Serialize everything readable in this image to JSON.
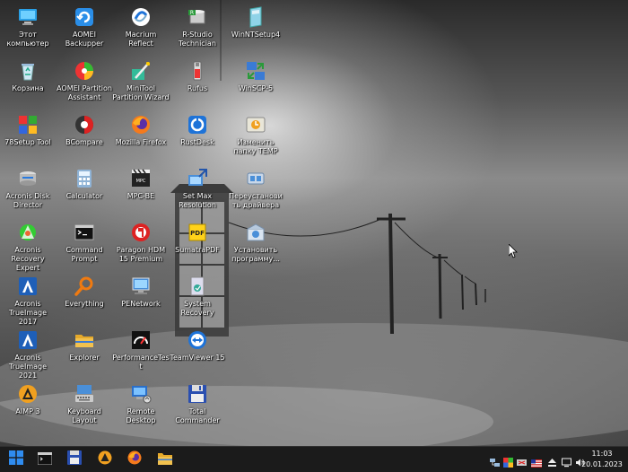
{
  "desktop": {
    "icons": [
      {
        "label": "Этот компьютер",
        "icon": "this-pc-icon"
      },
      {
        "label": "Корзина",
        "icon": "recycle-bin-icon"
      },
      {
        "label": "78Setup Tool",
        "icon": "setup-tool-icon"
      },
      {
        "label": "Acronis Disk Director",
        "icon": "acronis-disk-director-icon"
      },
      {
        "label": "Acronis Recovery Expert",
        "icon": "acronis-recovery-expert-icon"
      },
      {
        "label": "Acronis TrueImage 2017",
        "icon": "acronis-trueimage-icon"
      },
      {
        "label": "Acronis TrueImage 2021",
        "icon": "acronis-trueimage-icon"
      },
      {
        "label": "AIMP 3",
        "icon": "aimp-icon"
      },
      {
        "label": "AOMEI Backupper",
        "icon": "aomei-backupper-icon"
      },
      {
        "label": "AOMEI Partition Assistant",
        "icon": "aomei-partition-icon"
      },
      {
        "label": "BCompare",
        "icon": "bcompare-icon"
      },
      {
        "label": "Calculator",
        "icon": "calculator-icon"
      },
      {
        "label": "Command Prompt",
        "icon": "command-prompt-icon"
      },
      {
        "label": "Everything",
        "icon": "everything-search-icon"
      },
      {
        "label": "Explorer",
        "icon": "folder-icon"
      },
      {
        "label": "Keyboard Layout",
        "icon": "keyboard-icon"
      },
      {
        "label": "Macrium Reflect",
        "icon": "macrium-reflect-icon"
      },
      {
        "label": "MiniTool Partition Wizard",
        "icon": "minitool-icon"
      },
      {
        "label": "Mozilla Firefox",
        "icon": "firefox-icon"
      },
      {
        "label": "MPC-BE",
        "icon": "mpc-be-icon"
      },
      {
        "label": "Paragon HDM 15 Premium",
        "icon": "paragon-icon"
      },
      {
        "label": "PENetwork",
        "icon": "penetwork-icon"
      },
      {
        "label": "PerformanceTest",
        "icon": "performancetest-icon"
      },
      {
        "label": "Remote Desktop",
        "icon": "remote-desktop-icon"
      },
      {
        "label": "R-Studio Technician",
        "icon": "r-studio-icon"
      },
      {
        "label": "Rufus",
        "icon": "rufus-icon"
      },
      {
        "label": "RustDesk",
        "icon": "rustdesk-icon"
      },
      {
        "label": "Set Max Resolution",
        "icon": "set-max-resolution-icon"
      },
      {
        "label": "SumatraPDF",
        "icon": "sumatrapdf-icon"
      },
      {
        "label": "System Recovery",
        "icon": "system-recovery-icon"
      },
      {
        "label": "TeamViewer 15",
        "icon": "teamviewer-icon"
      },
      {
        "label": "Total Commander",
        "icon": "floppy-disk-icon"
      },
      {
        "label": "WinNTSetup4",
        "icon": "winntsetup-icon"
      },
      {
        "label": "WinSCP-5",
        "icon": "winscp-icon"
      },
      {
        "label": "Изменить папку TEMP",
        "icon": "change-temp-icon"
      },
      {
        "label": "Переустановить драйвера",
        "icon": "reinstall-drivers-icon"
      },
      {
        "label": "Установить программу...",
        "icon": "install-program-icon"
      }
    ]
  },
  "taskbar": {
    "buttons": [
      {
        "name": "start-button",
        "icon": "windows-logo-icon"
      },
      {
        "name": "taskbar-command-prompt",
        "icon": "command-prompt-icon"
      },
      {
        "name": "taskbar-total-commander",
        "icon": "floppy-disk-icon"
      },
      {
        "name": "taskbar-aimp",
        "icon": "aimp-icon"
      },
      {
        "name": "taskbar-firefox",
        "icon": "firefox-icon"
      },
      {
        "name": "taskbar-explorer",
        "icon": "folder-icon"
      }
    ],
    "tray": {
      "icons": [
        "network-adapter-icon",
        "color-palette-icon",
        "resolution-icon",
        "us-flag-icon",
        "eject-icon",
        "display-icon",
        "volume-icon"
      ],
      "time": "11:03",
      "date": "20.01.2023"
    }
  },
  "colors": {
    "taskbar": "#1b1b1b",
    "accent_blue": "#1e73d8",
    "aimp_orange": "#f0a020",
    "folder_yellow": "#f2c14e",
    "label_text": "#ffffff"
  }
}
